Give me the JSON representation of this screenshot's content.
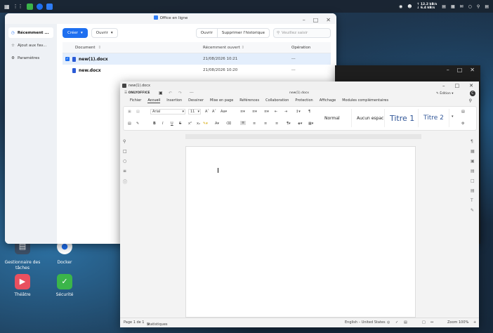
{
  "taskbar": {
    "speed_up": "↑ 12.2 kB/s",
    "speed_down": "↓ 6.4 kB/s"
  },
  "desktop": {
    "icons": [
      {
        "label": "Gestionnaire des tâches"
      },
      {
        "label": "Docker"
      },
      {
        "label": "Théâtre"
      },
      {
        "label": "Sécurité"
      }
    ]
  },
  "office_window": {
    "title": "Office en ligne",
    "sidebar": [
      {
        "label": "Récemment ..."
      },
      {
        "label": "Ajout aux fav..."
      },
      {
        "label": "Paramètres"
      }
    ],
    "toolbar": {
      "create": "Créer",
      "open": "Ouvrir",
      "open2": "Ouvrir",
      "clear_history": "Supprimer l'historique",
      "search_placeholder": "Veuillez saisir"
    },
    "columns": {
      "document": "Document",
      "recent": "Récemment ouvert",
      "operation": "Opération"
    },
    "rows": [
      {
        "name": "new(1).docx",
        "date": "21/08/2026 10:21",
        "op": "···"
      },
      {
        "name": "new.docx",
        "date": "21/08/2026 10:20",
        "op": "···"
      }
    ]
  },
  "editor": {
    "window_title": "new(1).docx",
    "brand": "ONLYOFFICE",
    "doc_title": "new(1).docx",
    "edit_mode": "Édition",
    "user_initial": "C",
    "tabs": [
      "Fichier",
      "Accueil",
      "Insertion",
      "Dessiner",
      "Mise en page",
      "Références",
      "Collaboration",
      "Protection",
      "Affichage",
      "Modules complémentaires"
    ],
    "font_name": "Arial",
    "font_size": "11",
    "styles": [
      "Normal",
      "Aucun espac",
      "Titre 1",
      "Titre 2"
    ],
    "status": {
      "page": "Page 1 de 1",
      "stats": "Statistiques",
      "lang": "English – United States",
      "zoom": "Zoom 100%"
    }
  }
}
